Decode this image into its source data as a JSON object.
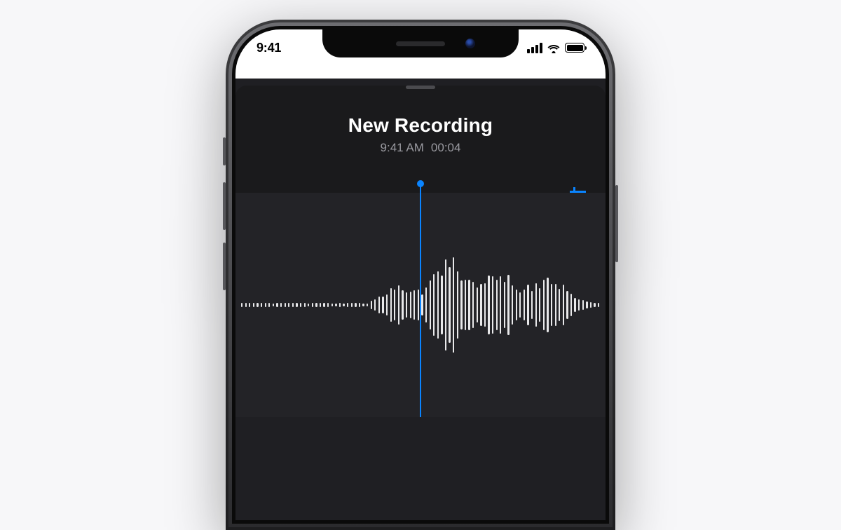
{
  "status_bar": {
    "time": "9:41"
  },
  "recording": {
    "title": "New Recording",
    "clock_time": "9:41 AM",
    "elapsed": "00:04"
  },
  "colors": {
    "accent": "#0a84ff"
  }
}
